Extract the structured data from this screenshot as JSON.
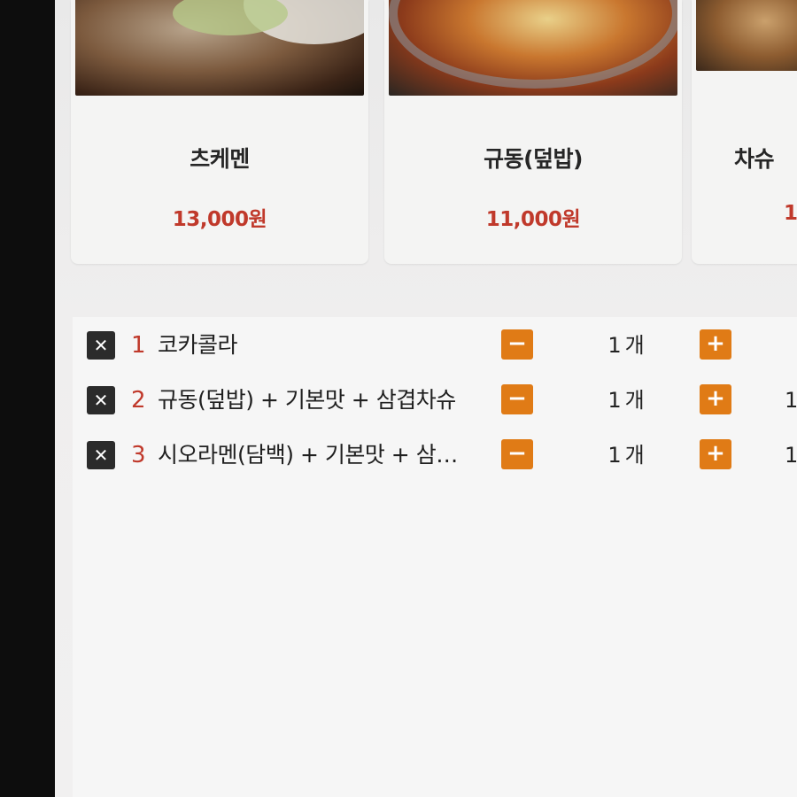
{
  "menu": {
    "cards": [
      {
        "name": "츠케멘",
        "price": "13,000원",
        "photo": "food-photo-tsukemen"
      },
      {
        "name": "규동(덮밥)",
        "price": "11,000원",
        "photo": "food-photo-gyudon"
      },
      {
        "name": "차슈",
        "price": "1",
        "photo": "food-photo-chashu"
      }
    ]
  },
  "cart": {
    "items": [
      {
        "index": "1",
        "name": "코카콜라",
        "minus": "−",
        "qty": "1",
        "unit": "개",
        "plus": "+",
        "partial": ""
      },
      {
        "index": "2",
        "name": "규동(덮밥) + 기본맛 + 삼겹차슈",
        "minus": "−",
        "qty": "1",
        "unit": "개",
        "plus": "+",
        "partial": "1"
      },
      {
        "index": "3",
        "name": "시오라멘(담백) + 기본맛 + 삼…",
        "minus": "−",
        "qty": "1",
        "unit": "개",
        "plus": "+",
        "partial": "1"
      }
    ],
    "delete_icon": "✕"
  },
  "colors": {
    "accent": "#e07b16",
    "price": "#c0392b",
    "delete": "#2b2b2b"
  }
}
